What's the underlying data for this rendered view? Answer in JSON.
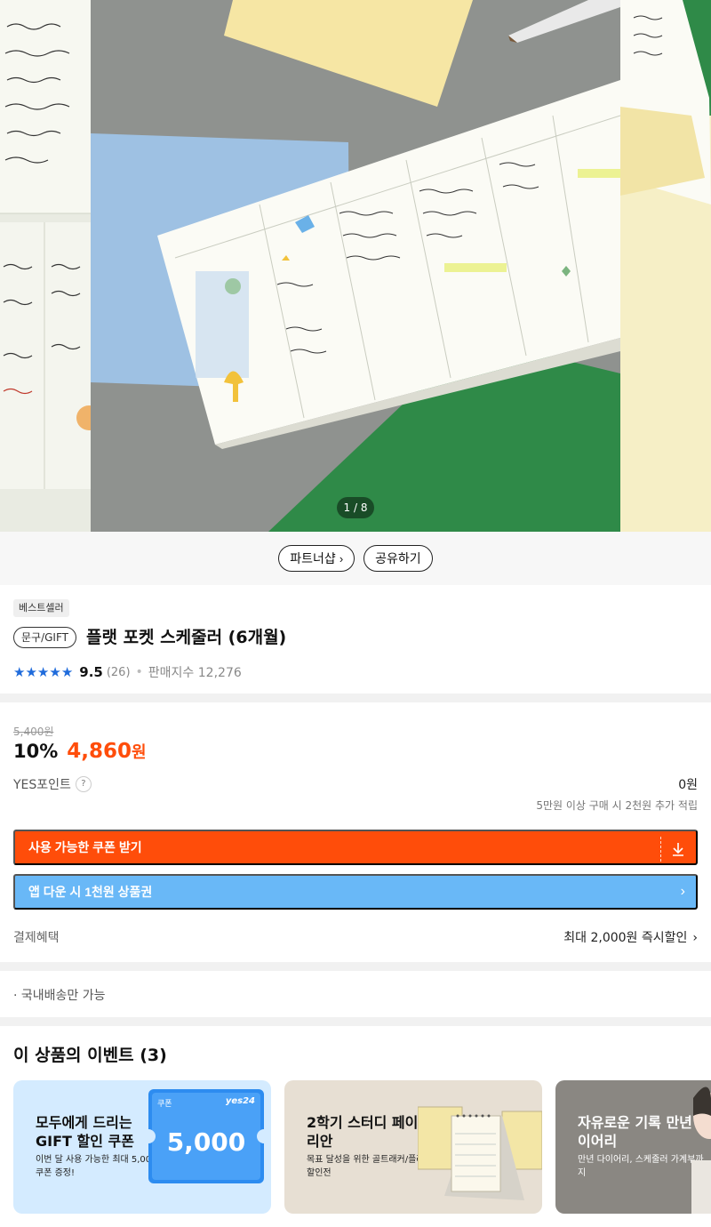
{
  "carousel": {
    "counter": "1 / 8",
    "current": 1,
    "total": 8
  },
  "actions": {
    "partner_label": "파트너샵",
    "share_label": "공유하기"
  },
  "product": {
    "badge": "베스트셀러",
    "category": "문구/GIFT",
    "title": "플랫 포켓 스케줄러 (6개월)",
    "rating": "9.5",
    "rating_value": 9.5,
    "rating_stars": 5,
    "review_count": "(26)",
    "sales_index": "판매지수 12,276"
  },
  "price": {
    "original": "5,400원",
    "discount": "10%",
    "sale": "4,860",
    "won": "원",
    "points_label": "YES포인트",
    "points_help": "?",
    "points_value": "0원",
    "points_note": "5만원 이상 구매 시 2천원 추가 적립",
    "coupon_button": "사용 가능한 쿠폰 받기",
    "app_button": "앱 다운 시 1천원 상품권",
    "payment_label": "결제혜택",
    "payment_value": "최대 2,000원 즉시할인"
  },
  "shipping": {
    "note": "· 국내배송만 가능"
  },
  "events": {
    "title": "이 상품의 이벤트 (3)",
    "cards": [
      {
        "title": "모두에게 드리는 GIFT 할인 쿠폰",
        "subtitle": "이번 달 사용 가능한 최대 5,000원 쿠폰 증정!",
        "coupon_tag": "쿠폰",
        "coupon_brand": "yes24",
        "coupon_amount": "5,000"
      },
      {
        "title": "2학기 스터디 페이퍼리안",
        "subtitle": "목표 달성을 위한 골트래커/플래너 할인전"
      },
      {
        "title": "자유로운 기록 만년 다이어리",
        "subtitle": "만년 다이어리, 스케줄러 가계부까지"
      }
    ]
  },
  "colors": {
    "accent_orange": "#ff4d0a",
    "app_blue": "#69b8f7",
    "star_blue": "#1f6bdb"
  },
  "icons": {
    "download": "download-icon",
    "chevron": "chevron-right-icon",
    "star": "star-icon"
  }
}
